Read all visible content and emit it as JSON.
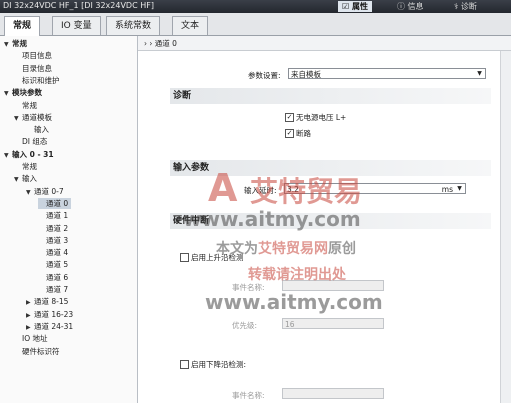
{
  "window": {
    "title": "DI 32x24VDC HF_1 [DI 32x24VDC HF]",
    "tabs": [
      "属性",
      "信息",
      "诊断"
    ]
  },
  "top_tabs": [
    "常规",
    "IO 变量",
    "系统常数",
    "文本"
  ],
  "tree": [
    {
      "label": "常规",
      "level": 0,
      "expanded": true
    },
    {
      "label": "项目信息",
      "level": 1
    },
    {
      "label": "目录信息",
      "level": 1
    },
    {
      "label": "标识和维护",
      "level": 1
    },
    {
      "label": "模块参数",
      "level": 0,
      "expanded": true
    },
    {
      "label": "常规",
      "level": 1
    },
    {
      "label": "通道模板",
      "level": 1,
      "expanded": true
    },
    {
      "label": "输入",
      "level": 2
    },
    {
      "label": "DI 组态",
      "level": 1
    },
    {
      "label": "输入 0 - 31",
      "level": 0,
      "expanded": true
    },
    {
      "label": "常规",
      "level": 1
    },
    {
      "label": "输入",
      "level": 1,
      "expanded": true
    },
    {
      "label": "通道 0-7",
      "level": 2,
      "expanded": true
    },
    {
      "label": "通道 0",
      "level": 3,
      "selected": true
    },
    {
      "label": "通道 1",
      "level": 3
    },
    {
      "label": "通道 2",
      "level": 3
    },
    {
      "label": "通道 3",
      "level": 3
    },
    {
      "label": "通道 4",
      "level": 3
    },
    {
      "label": "通道 5",
      "level": 3
    },
    {
      "label": "通道 6",
      "level": 3
    },
    {
      "label": "通道 7",
      "level": 3
    },
    {
      "label": "通道 8-15",
      "level": 2,
      "collapsed": true
    },
    {
      "label": "通道 16-23",
      "level": 2,
      "collapsed": true
    },
    {
      "label": "通道 24-31",
      "level": 2,
      "collapsed": true
    },
    {
      "label": "IO 地址",
      "level": 1
    },
    {
      "label": "硬件标识符",
      "level": 1
    }
  ],
  "breadcrumb": "›  ›  通道 0",
  "params": {
    "setting_label": "参数设置:",
    "setting_value": "来自模板"
  },
  "diag": {
    "title": "诊断",
    "no_supply": "无电源电压 L+",
    "wire_break": "断路"
  },
  "input_params": {
    "title": "输入参数",
    "delay_label": "输入延时:",
    "delay_value": "3.2",
    "delay_unit": "ms"
  },
  "hw_interrupt": {
    "title": "硬件中断",
    "rising_label": "启用上升沿检测",
    "event_label": "事件名称:",
    "priority_label": "优先级:",
    "priority_value": "16",
    "falling_label": "启用下降沿检测:",
    "event2_label": "事件名称:"
  },
  "watermark": {
    "brand": "艾特贸易",
    "url1": "www.aitmy.com",
    "line1a": "本文为",
    "line1b": "艾特贸易网",
    "line1c": "原创",
    "line2": "转载请注明出处",
    "url2": "www.aitmy.com"
  },
  "colors": {
    "accent": "#c8463c",
    "url": "#4a4a4a"
  }
}
